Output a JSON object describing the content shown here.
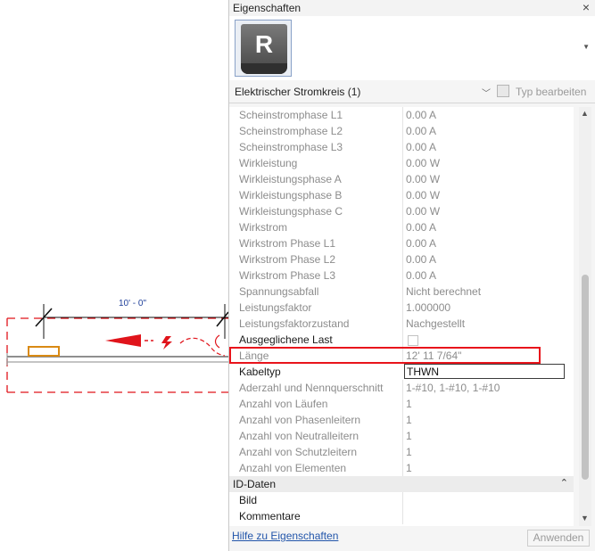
{
  "canvas": {
    "dimension_text": "10' - 0\""
  },
  "panel": {
    "title": "Eigenschaften",
    "close_glyph": "×",
    "type_icon_letter": "R",
    "selector_label": "Elektrischer Stromkreis (1)",
    "edit_type_label": "Typ bearbeiten",
    "properties": [
      {
        "label": "Scheinstromphase L1",
        "value": "0.00 A"
      },
      {
        "label": "Scheinstromphase L2",
        "value": "0.00 A"
      },
      {
        "label": "Scheinstromphase L3",
        "value": "0.00 A"
      },
      {
        "label": "Wirkleistung",
        "value": "0.00 W"
      },
      {
        "label": "Wirkleistungsphase A",
        "value": "0.00 W"
      },
      {
        "label": "Wirkleistungsphase B",
        "value": "0.00 W"
      },
      {
        "label": "Wirkleistungsphase C",
        "value": "0.00 W"
      },
      {
        "label": "Wirkstrom",
        "value": "0.00 A"
      },
      {
        "label": "Wirkstrom Phase L1",
        "value": "0.00 A"
      },
      {
        "label": "Wirkstrom Phase L2",
        "value": "0.00 A"
      },
      {
        "label": "Wirkstrom Phase L3",
        "value": "0.00 A"
      },
      {
        "label": "Spannungsabfall",
        "value": "Nicht berechnet"
      },
      {
        "label": "Leistungsfaktor",
        "value": "1.000000"
      },
      {
        "label": "Leistungsfaktorzustand",
        "value": "Nachgestellt"
      },
      {
        "label": "Ausgeglichene Last",
        "value": "",
        "checked": false
      },
      {
        "label": "Länge",
        "value": "12'  11 7/64\""
      },
      {
        "label": "Kabeltyp",
        "value": "THWN"
      },
      {
        "label": "Aderzahl und Nennquerschnitt",
        "value": "1-#10, 1-#10, 1-#10"
      },
      {
        "label": "Anzahl von Läufen",
        "value": "1"
      },
      {
        "label": "Anzahl von Phasenleitern",
        "value": "1"
      },
      {
        "label": "Anzahl von Neutralleitern",
        "value": "1"
      },
      {
        "label": "Anzahl von Schutzleitern",
        "value": "1"
      },
      {
        "label": "Anzahl von Elementen",
        "value": "1"
      }
    ],
    "group_id_label": "ID-Daten",
    "group_collapse_glyph": "⌃",
    "id_properties": [
      {
        "label": "Bild",
        "value": ""
      },
      {
        "label": "Kommentare",
        "value": ""
      }
    ],
    "help_link": "Hilfe zu Eigenschaften",
    "apply_button": "Anwenden"
  },
  "colors": {
    "highlight": "#e8141b",
    "dimension": "#1f3f9a",
    "circuit_red": "#e0141b",
    "fixture_orange": "#d98a14"
  },
  "icons": [
    "close-icon",
    "revit-family-icon",
    "dropdown-arrow-icon",
    "edit-type-icon",
    "scroll-up-icon",
    "scroll-down-icon",
    "collapse-group-icon"
  ]
}
